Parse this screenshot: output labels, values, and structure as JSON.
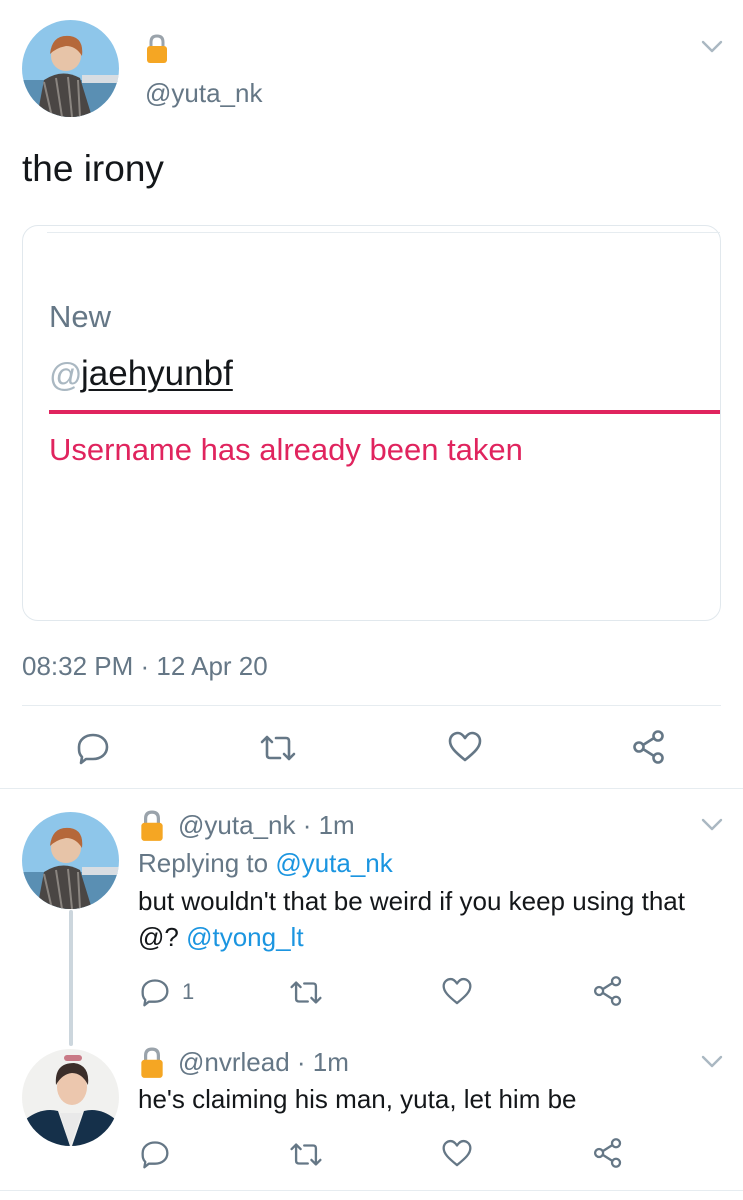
{
  "main_tweet": {
    "handle": "@yuta_nk",
    "text": "the irony",
    "timestamp": "08:32 PM · 12 Apr 20"
  },
  "card": {
    "label": "New",
    "at_symbol": "@",
    "username_value": "jaehyunbf",
    "error": "Username has already been taken"
  },
  "replies": [
    {
      "handle": "@yuta_nk",
      "time": "· 1m",
      "replying_prefix": "Replying to",
      "replying_to": "@yuta_nk",
      "text_line1": "but wouldn't that be weird if you keep using that",
      "text_line2_prefix": "@?",
      "text_line2_mention": "@tyong_lt",
      "reply_count": "1"
    },
    {
      "handle": "@nvrlead",
      "time": "· 1m",
      "text": "he's claiming his man, yuta, let him be"
    }
  ],
  "colors": {
    "error_red": "#e0245e",
    "link_blue": "#1b95e0",
    "muted_gray": "#657786",
    "lock_gold": "#f5a623"
  },
  "icons": [
    "lock-icon",
    "chevron-down-icon",
    "reply-icon",
    "retweet-icon",
    "like-icon",
    "share-icon"
  ]
}
